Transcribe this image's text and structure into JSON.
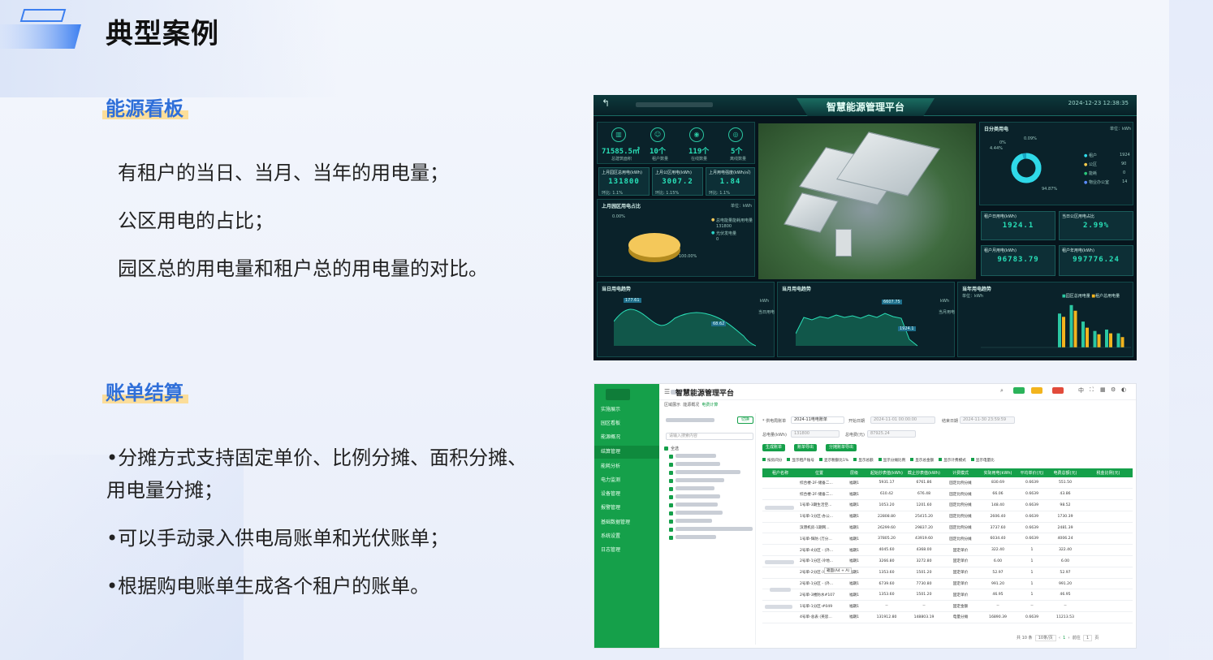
{
  "slide": {
    "title": "典型案例",
    "section1": {
      "tag": "能源看板",
      "lines": [
        "有租户的当日、当月、当年的用电量；",
        "公区用电的占比；",
        "园区总的用电量和租户总的用电量的对比。"
      ]
    },
    "section2": {
      "tag": "账单结算",
      "bullets": [
        "•分摊方式支持固定单价、比例分摊、面积分摊、",
        "用电量分摊；",
        "•可以手动录入供电局账单和光伏账单；",
        "•根据购电账单生成各个租户的账单。"
      ]
    }
  },
  "dashboard": {
    "title": "智慧能源管理平台",
    "timestamp": "2024-12-23 12:38:35",
    "stats": [
      {
        "value": "71585.5㎡",
        "label": "总建筑面积"
      },
      {
        "value": "10个",
        "label": "租户数量"
      },
      {
        "value": "119个",
        "label": "在线数量"
      },
      {
        "value": "5个",
        "label": "离线数量"
      }
    ],
    "kpis_left": [
      {
        "title": "上月园区总用电(kWh)",
        "value": "131800",
        "sub": "环比: 1.1%"
      },
      {
        "title": "上月公区用电(kWh)",
        "value": "3007.2",
        "sub": "环比: 1.15%"
      },
      {
        "title": "上月用电强度(kWh/㎡)",
        "value": "1.84",
        "sub": "环比: 1.1%"
      }
    ],
    "pie_panel": {
      "title": "上月园区用电占比",
      "unit": "单位：kWh",
      "label_top": "0.00%",
      "label_bottom": "100.00%",
      "legend": [
        "总电能量能耗用电量",
        "131800",
        "光伏发电量",
        "0"
      ]
    },
    "donut_panel": {
      "title": "日分类用电",
      "unit": "单位：kWh",
      "pct_a": "0.09%",
      "pct_b": "0%",
      "pct_c": "4.44%",
      "pct_main": "94.87%",
      "legend": [
        {
          "name": "租户",
          "value": "1924"
        },
        {
          "name": "公区",
          "value": "90"
        },
        {
          "name": "能耗",
          "value": "0"
        },
        {
          "name": "物业办公室",
          "value": "14"
        }
      ]
    },
    "kpis_right": [
      {
        "title": "租户日用电(kWh)",
        "value": "1924.1"
      },
      {
        "title": "当日公区用电占比",
        "value": "2.99%"
      },
      {
        "title": "租户月用电(kWh)",
        "value": "96783.79"
      },
      {
        "title": "租户年用电(kWh)",
        "value": "997776.24"
      }
    ],
    "charts": [
      {
        "title": "当日用电趋势",
        "unit": "kWh",
        "peak_label": "177.61",
        "low_label": "68.62",
        "legend": "当日用电"
      },
      {
        "title": "当月用电趋势",
        "unit": "kWh",
        "peak_label": "6607.75",
        "low_label": "1924.1",
        "legend": "当月用电"
      },
      {
        "title": "当年用电趋势",
        "unit": "单位：kWh",
        "legend": [
          "园区总用电量",
          "租户总用电量"
        ]
      }
    ]
  },
  "billing": {
    "title": "智慧能源管理平台",
    "nav": [
      "实施展示",
      "园区看板",
      "能源概况",
      "结算管理",
      "能耗分析",
      "电力监测",
      "设备管理",
      "报警管理",
      "基础数据管理",
      "系统设置",
      "日志管理"
    ],
    "breadcrumbs": [
      "区域展示",
      "能源概况",
      "电费计算"
    ],
    "tree_search_placeholder": "请输入搜索内容",
    "tree_btn": "切换",
    "tree_root": "全选",
    "form": {
      "supply_label": "* 供电局账单",
      "supply_value": "2024-11电电账单",
      "start_label": "开始日期",
      "start_value": "2024-11-01 00:00:00",
      "end_label": "结束日期",
      "end_value": "2024-11-30 23:59:59",
      "total_kwh_label": "总电量(kWh)",
      "total_kwh_value": "131800",
      "total_fee_label": "总电费(元)",
      "total_fee_value": "87925.24"
    },
    "buttons": [
      "生成账单",
      "账单导出",
      "分摊账单导出"
    ],
    "checkboxes": [
      "按房间分",
      "显示租户账号",
      "显示税额比1%",
      "显示总额",
      "显示分摊比例",
      "显示总金额",
      "显示计费模式",
      "显示电量比"
    ],
    "columns": [
      "租户名称",
      "位置",
      "层级",
      "起始抄表值(kWh)",
      "截止抄表值(kWh)",
      "计费模式",
      "实际用电(kWh)",
      "平均单价(元)",
      "电费总额(元)",
      "税金比例(元)"
    ],
    "rows": [
      [
        "",
        "综合楼-2F-储备二...",
        "福期1",
        "5931.17",
        "6761.86",
        "固定比例分摊",
        "830.69",
        "0.6639",
        "551.50",
        ""
      ],
      [
        "",
        "综合楼-2F-储备二...",
        "福期1",
        "610.42",
        "676.48",
        "固定比例分摊",
        "66.06",
        "0.6639",
        "43.86",
        ""
      ],
      [
        "",
        "1号单-3期生活空...",
        "福期1",
        "1053.20",
        "1201.60",
        "固定比例分摊",
        "148.40",
        "0.6639",
        "98.52",
        ""
      ],
      [
        "",
        "1号单-1分区-办公...",
        "福期1",
        "22808.80",
        "25415.20",
        "固定比例分摊",
        "2606.40",
        "0.6639",
        "1730.39",
        ""
      ],
      [
        "",
        "滨港机房-1期网...",
        "福期1",
        "26299.60",
        "29837.20",
        "固定比例分摊",
        "3737.60",
        "0.6639",
        "2481.39",
        ""
      ],
      [
        "",
        "1号单-辉防 (万分...",
        "福期1",
        "37805.20",
        "43919.60",
        "固定比例分摊",
        "6034.40",
        "0.6639",
        "4006.24",
        ""
      ],
      [
        "",
        "2号单-4分区 - (外...",
        "福期1",
        "4045.60",
        "4368.00",
        "固定单价",
        "322.40",
        "1",
        "322.40",
        ""
      ],
      [
        "",
        "2号单-1分区-冷地...",
        "福期1",
        "3266.80",
        "3272.80",
        "固定单价",
        "6.00",
        "1",
        "6.00",
        ""
      ],
      [
        "",
        "2号单-2分区-冷地...",
        "福期1",
        "1353.60",
        "1501.20",
        "固定单价",
        "52.97",
        "1",
        "52.97",
        ""
      ],
      [
        "",
        "2号单-1分区 - (外...",
        "福期1",
        "6739.60",
        "7730.80",
        "固定单价",
        "991.20",
        "1",
        "991.20",
        ""
      ],
      [
        "",
        "2号单-3楼防水#107",
        "福期1",
        "1353.60",
        "1501.20",
        "固定单价",
        "46.95",
        "1",
        "46.95",
        ""
      ],
      [
        "",
        "1号单-1分区-#049",
        "福期1",
        "--",
        "--",
        "固定金额",
        "--",
        "--",
        "--",
        ""
      ],
      [
        "",
        "4号单-总表 (英思...",
        "福期1",
        "131912.80",
        "148803.19",
        "电量分摊",
        "16890.39",
        "0.6639",
        "11213.53",
        ""
      ]
    ],
    "tooltip": "箱面(A4 + A)",
    "pager": {
      "total": "共 10 条",
      "size": "10条/页",
      "page": "1",
      "goto": "前往",
      "page_unit": "页"
    }
  }
}
